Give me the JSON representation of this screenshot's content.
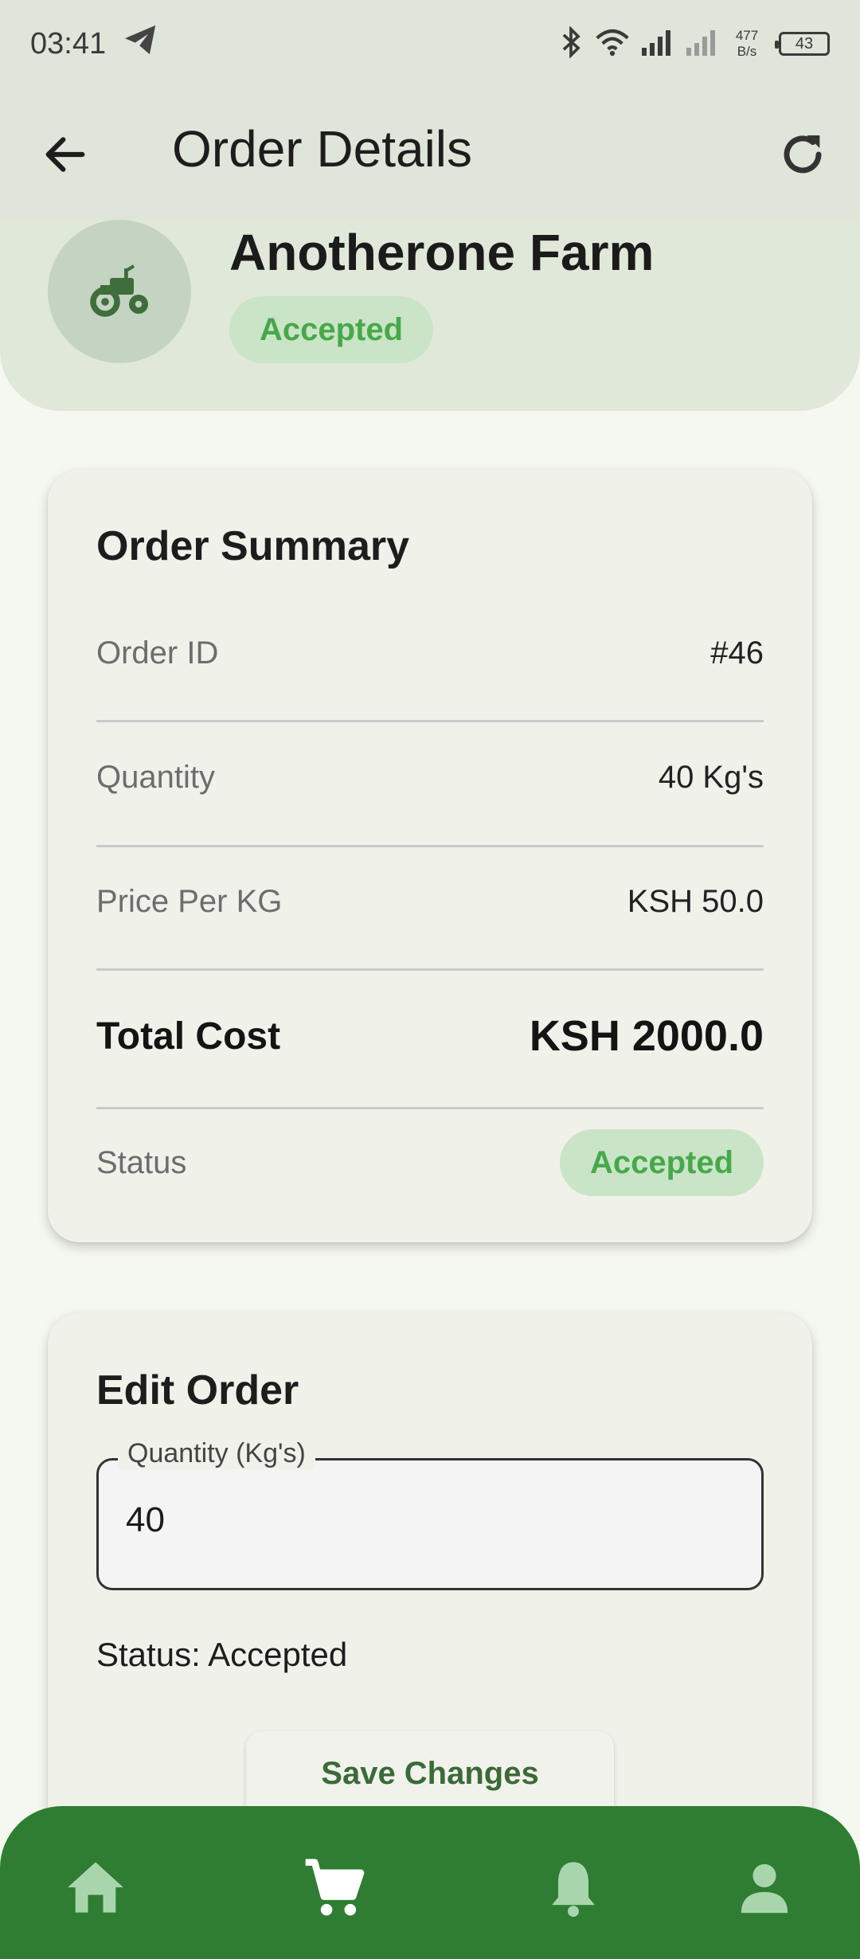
{
  "status_bar": {
    "time": "03:41",
    "net_speed_value": "477",
    "net_speed_unit": "B/s",
    "battery": "43"
  },
  "app_bar": {
    "title": "Order Details",
    "back_icon": "arrow-back-icon",
    "refresh_icon": "refresh-icon"
  },
  "farm": {
    "name": "Anotherone Farm",
    "status": "Accepted",
    "avatar_icon": "tractor-icon"
  },
  "summary": {
    "title": "Order Summary",
    "rows": [
      {
        "label": "Order ID",
        "value": "#46"
      },
      {
        "label": "Quantity",
        "value": "40 Kg's"
      },
      {
        "label": "Price Per KG",
        "value": "KSH 50.0"
      }
    ],
    "total_label": "Total Cost",
    "total_value": "KSH 2000.0",
    "status_label": "Status",
    "status_value": "Accepted"
  },
  "edit": {
    "title": "Edit Order",
    "quantity_label": "Quantity (Kg's)",
    "quantity_value": "40",
    "status_text": "Status: Accepted",
    "save_label": "Save Changes"
  },
  "bottom_nav": {
    "items": [
      "home-icon",
      "cart-icon",
      "bell-icon",
      "person-icon"
    ],
    "active": "cart-icon"
  },
  "colors": {
    "primary": "#2e7d32",
    "chip_bg": "#c9e4c7",
    "chip_text": "#47a84a",
    "header_bg": "#e0e8da",
    "appbar_bg": "#dfe5d9",
    "nav_inactive": "#a9d5ac"
  }
}
